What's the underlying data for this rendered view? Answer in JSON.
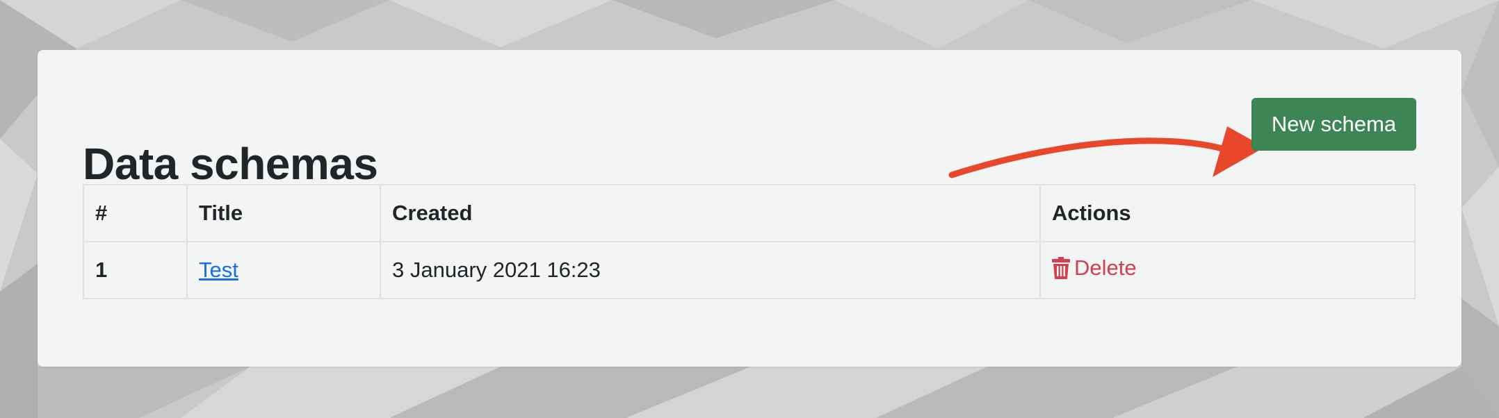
{
  "page": {
    "title": "Data schemas"
  },
  "toolbar": {
    "new_schema_label": "New schema"
  },
  "table": {
    "headers": {
      "num": "#",
      "title": "Title",
      "created": "Created",
      "actions": "Actions"
    },
    "rows": [
      {
        "num": "1",
        "title": "Test",
        "created": "3 January 2021 16:23",
        "delete_label": "Delete"
      }
    ]
  },
  "icons": {
    "delete": "trash-icon",
    "annotation": "arrow-annotation"
  },
  "colors": {
    "primary_button": "#3e8556",
    "link": "#1a6fe0",
    "danger": "#d2404d",
    "annotation_arrow": "#e8472b"
  }
}
